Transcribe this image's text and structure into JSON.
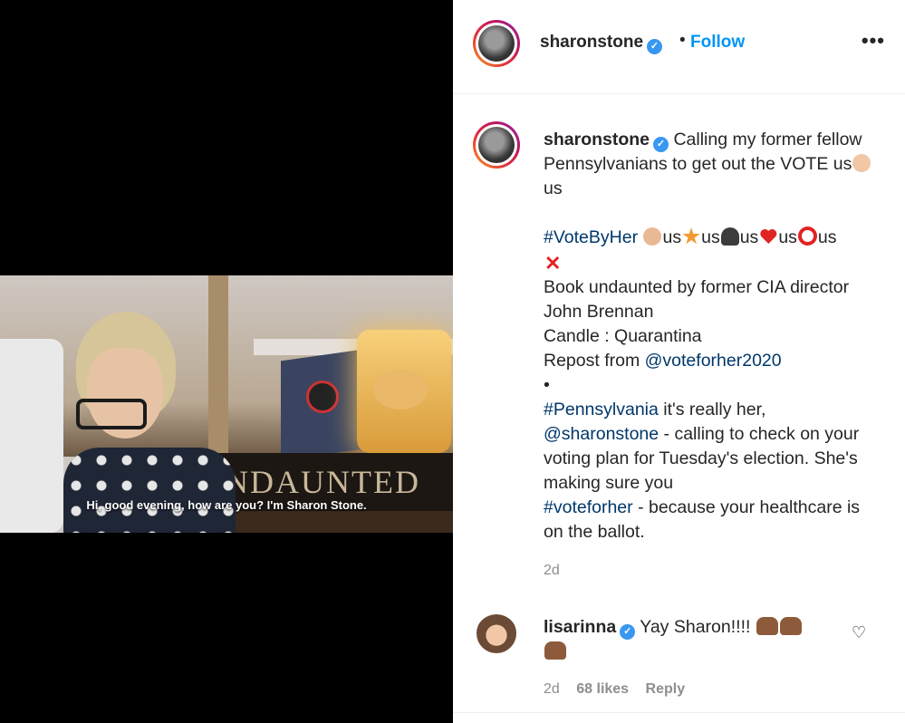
{
  "header": {
    "username": "sharonstone",
    "separator": "•",
    "follow_label": "Follow",
    "more_label": "•••"
  },
  "video": {
    "caption": "Hi, good evening, how are you? I'm Sharon Stone.",
    "book_text": "UNDAUNTED"
  },
  "post": {
    "username": "sharonstone",
    "line1": "Calling my former fellow Pennsylvanians to get out the VOTE us",
    "line1_tail": "us",
    "hashtag_voteforher": "#VoteByHer",
    "emoji_us": "us",
    "book_line": "Book undaunted by former CIA director John Brennan",
    "candle_line": "Candle : Quarantina",
    "repost_prefix": "Repost from",
    "repost_handle": "@voteforher2020",
    "bullet": "•",
    "hashtag_pa": "#Pennsylvania",
    "pa_rest": " it's really her,",
    "mention": "@sharonstone",
    "mention_rest": " - calling to check on your voting plan for Tuesday's election. She's making sure you",
    "hashtag_vfh": "#voteforher",
    "end_text": " - because your healthcare is on the ballot.",
    "time": "2d"
  },
  "comment": {
    "username": "lisarinna",
    "text": "Yay Sharon!!!!",
    "time": "2d",
    "likes": "68 likes",
    "reply_label": "Reply"
  }
}
